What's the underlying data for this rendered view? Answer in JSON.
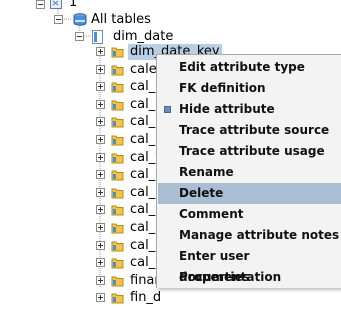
{
  "tree": {
    "root_label": "1",
    "all_tables_label": "All tables",
    "table_label": "dim_date",
    "attributes": [
      {
        "label": "dim_date_key",
        "selected": true
      },
      {
        "label": "caler"
      },
      {
        "label": "cal_c"
      },
      {
        "label": "cal_c"
      },
      {
        "label": "cal_c"
      },
      {
        "label": "cal_c"
      },
      {
        "label": "cal_v"
      },
      {
        "label": "cal_v"
      },
      {
        "label": "cal_c"
      },
      {
        "label": "cal_r"
      },
      {
        "label": "cal_r"
      },
      {
        "label": "cal_c"
      },
      {
        "label": "cal_y"
      },
      {
        "label": "finar"
      },
      {
        "label": "fin_d"
      }
    ]
  },
  "context_menu": {
    "items": [
      {
        "label": "Edit attribute type"
      },
      {
        "label": "FK definition"
      },
      {
        "label": "Hide attribute",
        "checkbox": true
      },
      {
        "label": "Trace attribute source"
      },
      {
        "label": "Trace attribute usage"
      },
      {
        "label": "Rename"
      },
      {
        "label": "Delete",
        "highlighted": true
      },
      {
        "label": "Comment"
      },
      {
        "label": "Manage attribute notes"
      },
      {
        "label": "Enter user documentation"
      },
      {
        "label": "Properties"
      }
    ]
  },
  "colors": {
    "selection": "#b8cfe5",
    "menu_background": "#f3f3f3",
    "menu_highlight": "#a9bdd3",
    "folder_yellow": "#f4c542",
    "table_blue": "#4a90d9"
  }
}
